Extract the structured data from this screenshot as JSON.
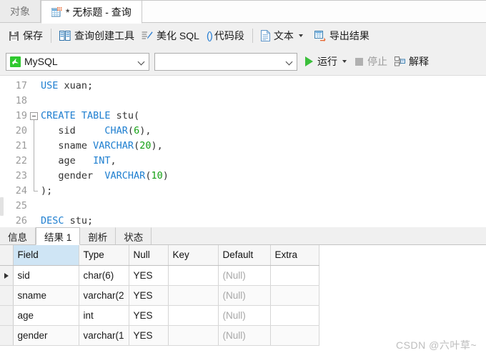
{
  "window": {
    "tabs": [
      {
        "label": "对象",
        "active": false,
        "icon": "object-tab-icon"
      },
      {
        "label": "* 无标题 - 查询",
        "active": true,
        "icon": "query-grid-icon"
      }
    ]
  },
  "toolbar": {
    "save_label": "保存",
    "query_builder_label": "查询创建工具",
    "beautify_sql_label": "美化 SQL",
    "code_snippet_label": "代码段",
    "text_label": "文本",
    "export_result_label": "导出结果"
  },
  "toolbar2": {
    "database_value": "MySQL",
    "connection_value": "",
    "run_label": "运行",
    "stop_label": "停止",
    "explain_label": "解释"
  },
  "editor": {
    "lines": [
      {
        "num": "17",
        "indent": 1,
        "tokens": [
          {
            "t": "USE",
            "c": "kw"
          },
          {
            "t": " xuan;",
            "c": "pun"
          }
        ]
      },
      {
        "num": "18",
        "indent": 1,
        "tokens": []
      },
      {
        "num": "19",
        "indent": 0,
        "fold": "start",
        "tokens": [
          {
            "t": "CREATE TABLE",
            "c": "kw"
          },
          {
            "t": " stu(",
            "c": "pun"
          }
        ]
      },
      {
        "num": "20",
        "indent": 0,
        "tokens": [
          {
            "t": "   sid     ",
            "c": "pun"
          },
          {
            "t": "CHAR",
            "c": "kw"
          },
          {
            "t": "(",
            "c": "pun"
          },
          {
            "t": "6",
            "c": "num"
          },
          {
            "t": "),",
            "c": "pun"
          }
        ]
      },
      {
        "num": "21",
        "indent": 0,
        "tokens": [
          {
            "t": "   sname ",
            "c": "pun"
          },
          {
            "t": "VARCHAR",
            "c": "kw"
          },
          {
            "t": "(",
            "c": "pun"
          },
          {
            "t": "20",
            "c": "num"
          },
          {
            "t": "),",
            "c": "pun"
          }
        ]
      },
      {
        "num": "22",
        "indent": 0,
        "tokens": [
          {
            "t": "   age   ",
            "c": "pun"
          },
          {
            "t": "INT",
            "c": "kw"
          },
          {
            "t": ",",
            "c": "pun"
          }
        ]
      },
      {
        "num": "23",
        "indent": 0,
        "tokens": [
          {
            "t": "   gender  ",
            "c": "pun"
          },
          {
            "t": "VARCHAR",
            "c": "kw"
          },
          {
            "t": "(",
            "c": "pun"
          },
          {
            "t": "10",
            "c": "num"
          },
          {
            "t": ")",
            "c": "pun"
          }
        ]
      },
      {
        "num": "24",
        "indent": 0,
        "fold": "end",
        "tokens": [
          {
            "t": ");",
            "c": "pun"
          }
        ]
      },
      {
        "num": "25",
        "indent": 1,
        "tokens": []
      },
      {
        "num": "26",
        "indent": 1,
        "tokens": [
          {
            "t": "DESC",
            "c": "kw"
          },
          {
            "t": " stu;",
            "c": "pun"
          }
        ]
      }
    ]
  },
  "result_tabs": [
    {
      "label": "信息",
      "active": false
    },
    {
      "label": "结果 1",
      "active": true
    },
    {
      "label": "剖析",
      "active": false
    },
    {
      "label": "状态",
      "active": false
    }
  ],
  "result_grid": {
    "columns": [
      "Field",
      "Type",
      "Null",
      "Key",
      "Default",
      "Extra"
    ],
    "rows": [
      {
        "current": true,
        "cells": [
          "sid",
          "char(6)",
          "YES",
          "",
          "(Null)",
          ""
        ]
      },
      {
        "current": false,
        "cells": [
          "sname",
          "varchar(2",
          "YES",
          "",
          "(Null)",
          ""
        ]
      },
      {
        "current": false,
        "cells": [
          "age",
          "int",
          "YES",
          "",
          "(Null)",
          ""
        ]
      },
      {
        "current": false,
        "cells": [
          "gender",
          "varchar(1",
          "YES",
          "",
          "(Null)",
          ""
        ]
      }
    ],
    "null_token": "(Null)"
  },
  "watermark": {
    "text": "CSDN @六叶草~"
  },
  "colors": {
    "keyword": "#1f7fd0",
    "number": "#14a014",
    "accent_tab_selected": "#cfe5f5",
    "chrome_bg": "#f0f0f0",
    "run_green": "#3bbf3b"
  }
}
